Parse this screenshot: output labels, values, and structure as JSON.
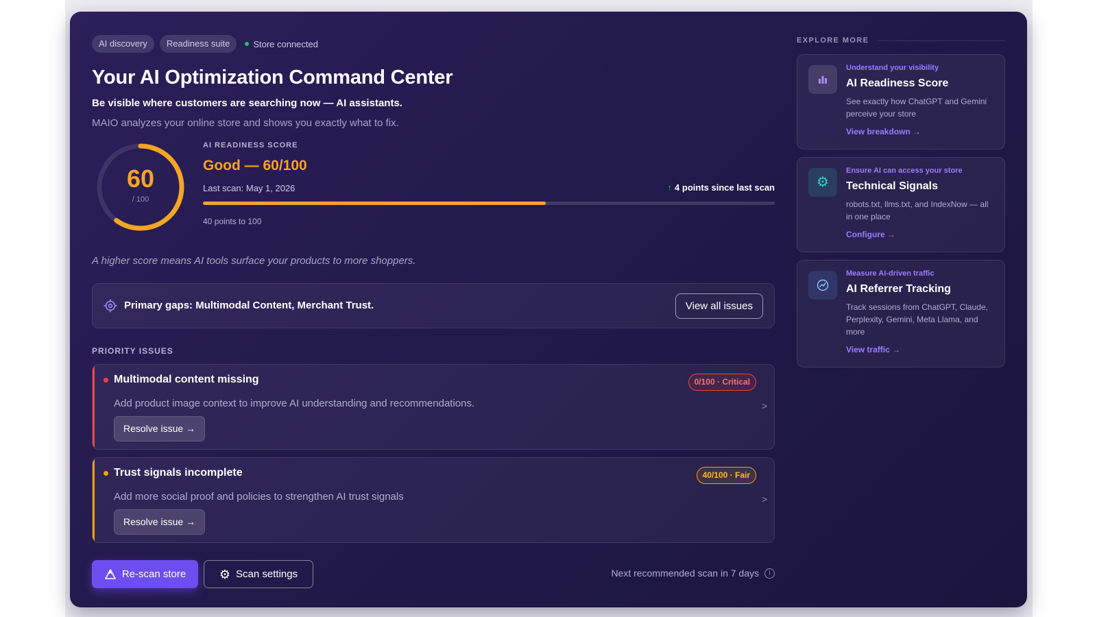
{
  "header": {
    "chips": [
      "AI discovery",
      "Readiness suite"
    ],
    "status": "Store connected",
    "title": "Your AI Optimization Command Center",
    "subtitle": "Be visible where customers are searching now — AI assistants.",
    "description": "MAIO analyzes your online store and shows you exactly what to fix."
  },
  "score": {
    "value": 60,
    "value_text": "60",
    "denominator": "/ 100",
    "label": "AI READINESS SCORE",
    "headline": "Good — 60/100",
    "last_scan": "Last scan: May 1, 2026",
    "delta": "4 points since last scan",
    "progress_fraction": 0.6,
    "remaining": "40 points to 100",
    "tagline": "A higher score means AI tools surface your products to more shoppers."
  },
  "gaps": {
    "text": "Primary gaps: Multimodal Content, Merchant Trust.",
    "button": "View all issues"
  },
  "priority": {
    "label": "PRIORITY ISSUES",
    "issues": [
      {
        "title": "Multimodal content missing",
        "description": "Add product image context to improve AI understanding and recommendations.",
        "badge": "0/100 · Critical",
        "severity": "critical",
        "button": "Resolve issue →"
      },
      {
        "title": "Trust signals incomplete",
        "description": "Add more social proof and policies to strengthen AI trust signals",
        "badge": "40/100 · Fair",
        "severity": "fair",
        "button": "Resolve issue →"
      }
    ]
  },
  "footer": {
    "rescan": "Re-scan store",
    "settings": "Scan settings",
    "next_scan": "Next recommended scan in 7 days"
  },
  "explore": {
    "heading": "EXPLORE MORE",
    "cards": [
      {
        "kicker": "Understand your visibility",
        "title": "AI Readiness Score",
        "description": "See exactly how ChatGPT and Gemini perceive your store",
        "link": "View breakdown →",
        "icon": "bar-chart-icon"
      },
      {
        "kicker": "Ensure AI can access your store",
        "title": "Technical Signals",
        "description": "robots.txt, llms.txt, and IndexNow — all in one place",
        "link": "Configure →",
        "icon": "gear-icon"
      },
      {
        "kicker": "Measure AI-driven traffic",
        "title": "AI Referrer Tracking",
        "description": "Track sessions from ChatGPT, Claude, Perplexity, Gemini, Meta Llama, and more",
        "link": "View traffic →",
        "icon": "trend-icon"
      }
    ]
  },
  "colors": {
    "accent": "#f5a524",
    "primary": "#6d4ef0",
    "critical": "#ef4444",
    "fair": "#f59e0b",
    "success": "#22c55e",
    "link": "#9b7cff"
  }
}
